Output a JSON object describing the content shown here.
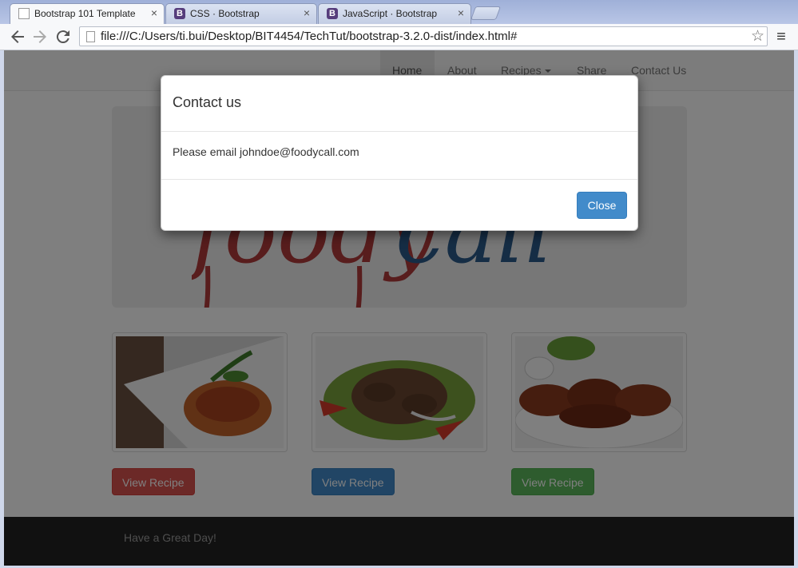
{
  "browser": {
    "tabs": [
      {
        "title": "Bootstrap 101 Template",
        "icon": "document-icon",
        "active": true
      },
      {
        "title": "CSS · Bootstrap",
        "icon": "bootstrap-icon",
        "active": false
      },
      {
        "title": "JavaScript · Bootstrap",
        "icon": "bootstrap-icon",
        "active": false
      }
    ],
    "tab_close_glyph": "×",
    "bootstrap_glyph": "B",
    "url": "file:///C:/Users/ti.bui/Desktop/BIT4454/TechTut/bootstrap-3.2.0-dist/index.html#"
  },
  "nav": {
    "items": [
      "Home",
      "About",
      "Recipes",
      "Share",
      "Contact Us"
    ],
    "active": "Home"
  },
  "logo": {
    "text": "foodycall"
  },
  "recipes": [
    {
      "button_label": "View Recipe",
      "color": "#d9534f",
      "image": "pasta"
    },
    {
      "button_label": "View Recipe",
      "color": "#428bca",
      "image": "beef-salad"
    },
    {
      "button_label": "View Recipe",
      "color": "#5cb85c",
      "image": "chicken-wings"
    }
  ],
  "footer": {
    "text": "Have a Great Day!"
  },
  "modal": {
    "title": "Contact us",
    "body": "Please email johndoe@foodycall.com",
    "close_label": "Close",
    "accent": "#428bca"
  }
}
